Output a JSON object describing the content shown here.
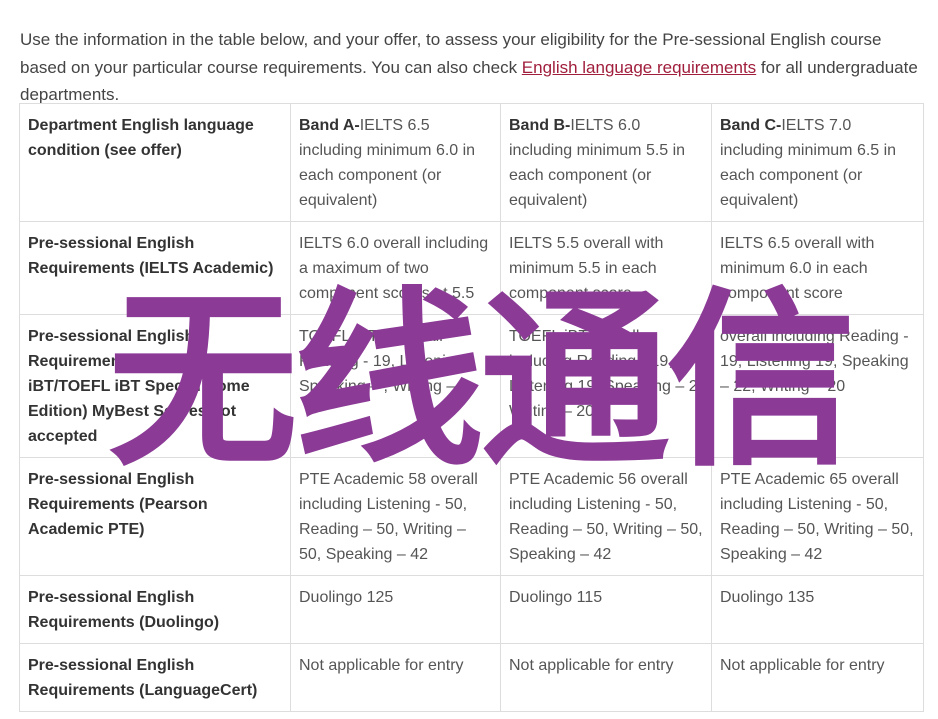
{
  "intro": {
    "before_link": "Use the information in the table below, and your offer, to assess your eligibility for the Pre-sessional English course based on your particular course requirements. You can also check ",
    "link": "English language requirements",
    "after_link": " for all undergraduate departments."
  },
  "table": {
    "header": {
      "label": "Department English language condition (see offer)",
      "bands": [
        {
          "name": "Band A-",
          "text": "IELTS 6.5 including minimum 6.0 in each component (or equivalent)"
        },
        {
          "name": "Band B-",
          "text": "IELTS 6.0 including minimum 5.5 in each component (or equivalent)"
        },
        {
          "name": "Band C-",
          "text": "IELTS 7.0 including minimum 6.5 in each component (or equivalent)"
        }
      ]
    },
    "rows": [
      {
        "label": "Pre-sessional English Requirements (IELTS Academic)",
        "cells": [
          "IELTS 6.0 overall including a maximum of two component scores at 5.5",
          "IELTS 5.5 overall with minimum 5.5 in each component score",
          "IELTS 6.5 overall with minimum 6.0 in each component score"
        ]
      },
      {
        "label": "Pre-sessional English Requirements (TOEFL iBT/TOEFL iBT Special Home Edition) MyBest Scores not accepted",
        "cells": [
          "TOEFL iBT 8 overall Reading - 19, Listening - Speaking – , Writing – 2",
          "TOEFL iBT overall including Reading - 19, Listening 19, Speaking – 2, Writing – 20",
          "overall including Reading - 19, Listening 19, Speaking – 22, Writing – 20"
        ]
      },
      {
        "label": "Pre-sessional English Requirements (Pearson Academic PTE)",
        "cells": [
          "PTE Academic 58 overall including Listening - 50, Reading – 50, Writing – 50, Speaking – 42",
          "PTE Academic 56 overall including Listening - 50, Reading – 50, Writing – 50, Speaking – 42",
          "PTE Academic 65 overall including Listening - 50, Reading – 50, Writing – 50, Speaking – 42"
        ]
      },
      {
        "label": "Pre-sessional English Requirements (Duolingo)",
        "cells": [
          "Duolingo 125",
          "Duolingo 115",
          "Duolingo 135"
        ]
      },
      {
        "label": "Pre-sessional English Requirements (LanguageCert)",
        "cells": [
          "Not applicable for entry",
          "Not applicable for entry",
          "Not applicable for entry"
        ]
      }
    ]
  },
  "watermark": {
    "text": "无线通信",
    "color": "#8b3a96"
  }
}
